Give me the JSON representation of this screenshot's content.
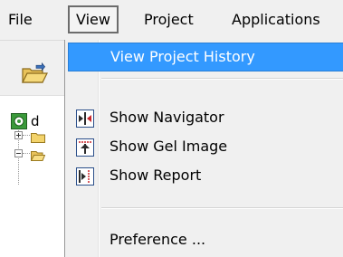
{
  "menubar": {
    "items": [
      {
        "label": "File"
      },
      {
        "label": "View"
      },
      {
        "label": "Project"
      },
      {
        "label": "Applications"
      }
    ]
  },
  "tree": {
    "root_label": "d"
  },
  "view_menu": {
    "items": [
      {
        "label": "View Project History",
        "highlighted": true
      },
      {
        "label": "Show Navigator",
        "icon": "navigator-icon"
      },
      {
        "label": "Show Gel Image",
        "icon": "gel-image-icon"
      },
      {
        "label": "Show Report",
        "icon": "report-icon"
      },
      {
        "label": "Preference ..."
      }
    ]
  },
  "colors": {
    "highlight": "#3399ff",
    "menu_background": "#f0f0f0"
  }
}
